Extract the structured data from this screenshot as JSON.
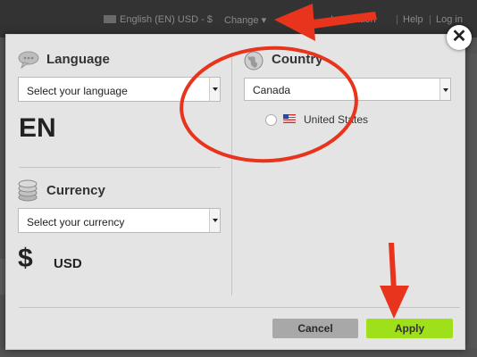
{
  "topbar": {
    "locale": "English (EN) USD - $",
    "change": "Change ▾",
    "inspiration": "Inspiration",
    "help": "Help",
    "login": "Log in",
    "separator": "|"
  },
  "modal": {
    "close": "✕",
    "language": {
      "title": "Language",
      "select_value": "Select your language",
      "code": "EN"
    },
    "currency": {
      "title": "Currency",
      "select_value": "Select your currency",
      "symbol": "$",
      "code": "USD"
    },
    "country": {
      "title": "Country",
      "select_value": "Canada",
      "options": [
        {
          "label": "United States",
          "flag": "us-flag",
          "selected": false
        }
      ]
    },
    "buttons": {
      "cancel": "Cancel",
      "apply": "Apply"
    }
  },
  "colors": {
    "apply_button": "#9fe01a",
    "cancel_button": "#a8a8a8",
    "annotation": "#e8341c"
  }
}
